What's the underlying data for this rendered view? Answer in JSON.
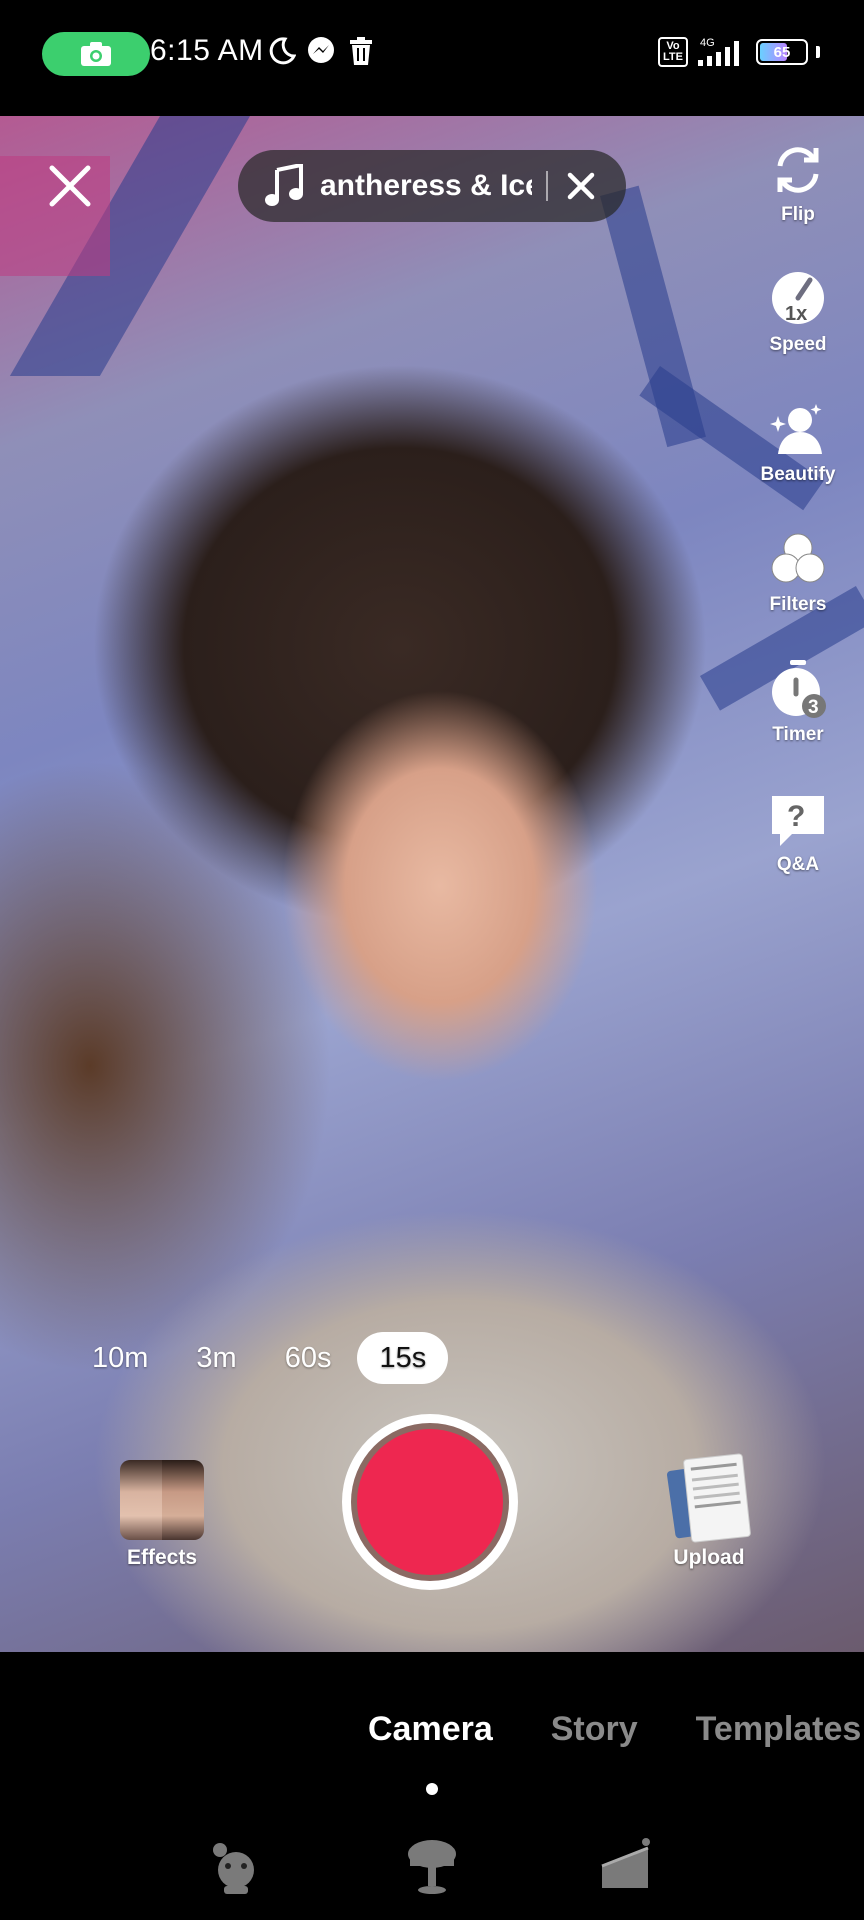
{
  "status_bar": {
    "time": "6:15 AM",
    "volte": "Vo\nLTE",
    "network": "4G",
    "battery_level": "65",
    "battery_fraction": 0.65,
    "icons": [
      "camera-icon",
      "moon-icon",
      "messenger-icon",
      "trash-icon",
      "signal-icon",
      "battery-icon"
    ]
  },
  "top_bar": {
    "music_title": "antheress & Ice",
    "close_icon": "close-icon",
    "music_icon": "music-note-icon"
  },
  "right_rail": [
    {
      "id": "flip",
      "label": "Flip",
      "icon": "flip-icon"
    },
    {
      "id": "speed",
      "label": "Speed",
      "icon": "speed-icon",
      "value": "1x"
    },
    {
      "id": "beautify",
      "label": "Beautify",
      "icon": "beautify-icon"
    },
    {
      "id": "filters",
      "label": "Filters",
      "icon": "filters-icon"
    },
    {
      "id": "timer",
      "label": "Timer",
      "icon": "timer-icon",
      "value": "3"
    },
    {
      "id": "qa",
      "label": "Q&A",
      "icon": "qa-icon"
    }
  ],
  "durations": [
    "10m",
    "3m",
    "60s",
    "15s"
  ],
  "selected_duration": "15s",
  "bottom": {
    "effects_label": "Effects",
    "upload_label": "Upload"
  },
  "modes": [
    "Camera",
    "Story",
    "Templates"
  ],
  "selected_mode": "Camera",
  "colors": {
    "record": "#ee2750",
    "rec_pill": "#3ccf6e"
  }
}
